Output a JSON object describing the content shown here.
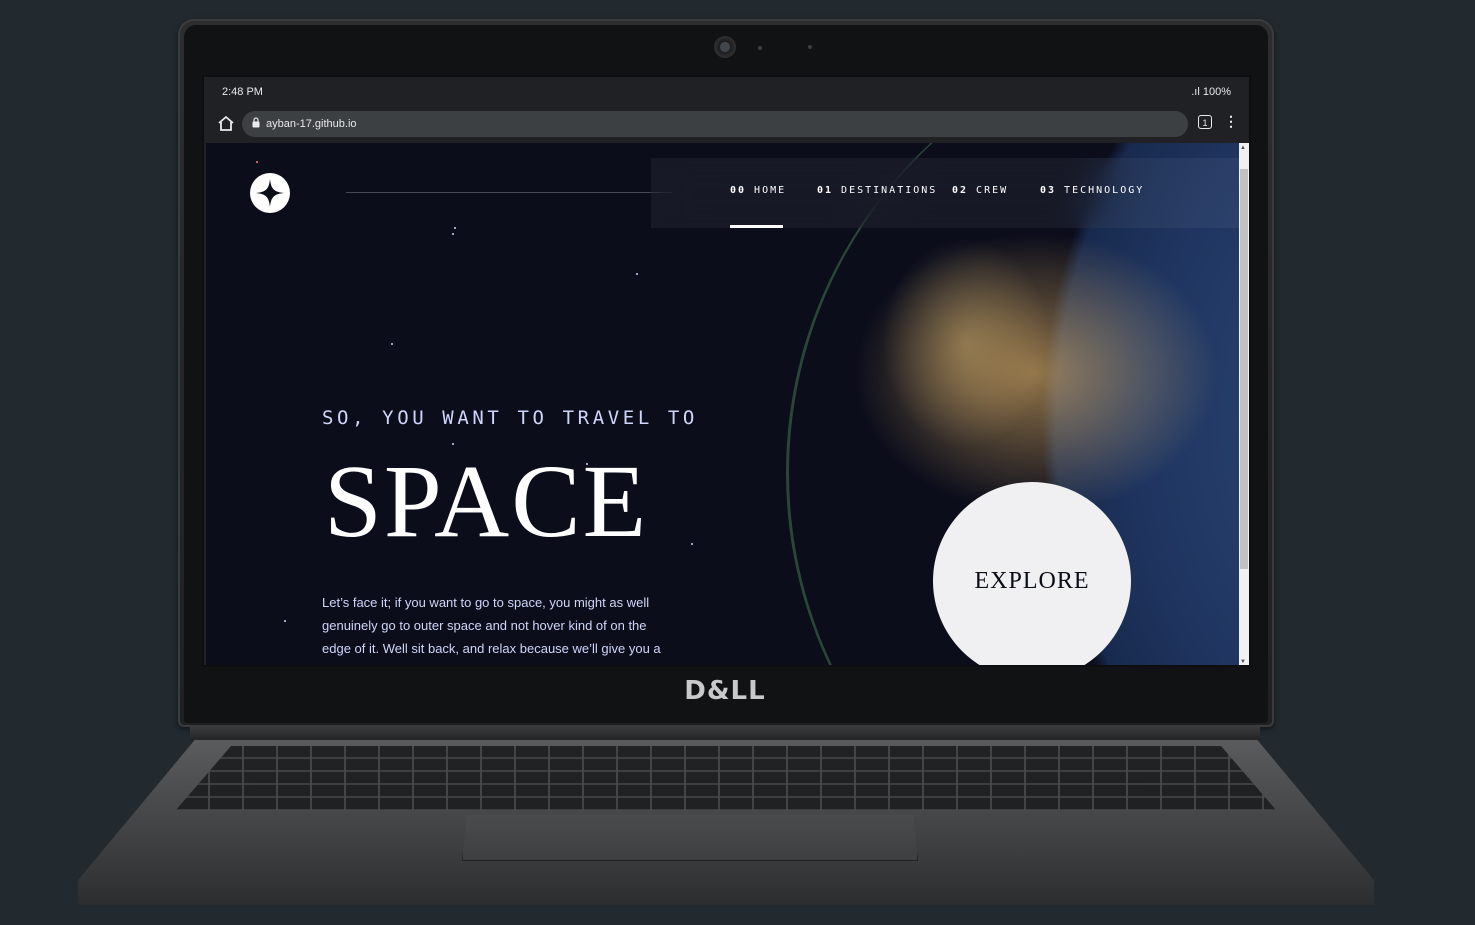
{
  "device": {
    "brand": "D&LL"
  },
  "status_bar": {
    "time": "2:48 PM",
    "battery": ".ıl 100%"
  },
  "browser": {
    "url": "ayban-17.github.io",
    "tab_count": "1"
  },
  "nav": {
    "items": [
      {
        "num": "00",
        "label": "HOME",
        "active": true
      },
      {
        "num": "01",
        "label": "DESTINATIONS",
        "active": false
      },
      {
        "num": "02",
        "label": "CREW",
        "active": false
      },
      {
        "num": "03",
        "label": "TECHNOLOGY",
        "active": false
      }
    ]
  },
  "hero": {
    "subtitle": "SO, YOU WANT TO TRAVEL TO",
    "title": "SPACE",
    "body": "Let’s face it; if you want to go to space, you might as well genuinely go to outer space and not hover kind of on the edge of it. Well sit back, and relax because we’ll give you a",
    "explore_label": "EXPLORE"
  },
  "colors": {
    "background": "#0b0d17",
    "accent_light": "#d0d6f9",
    "white": "#ffffff"
  }
}
